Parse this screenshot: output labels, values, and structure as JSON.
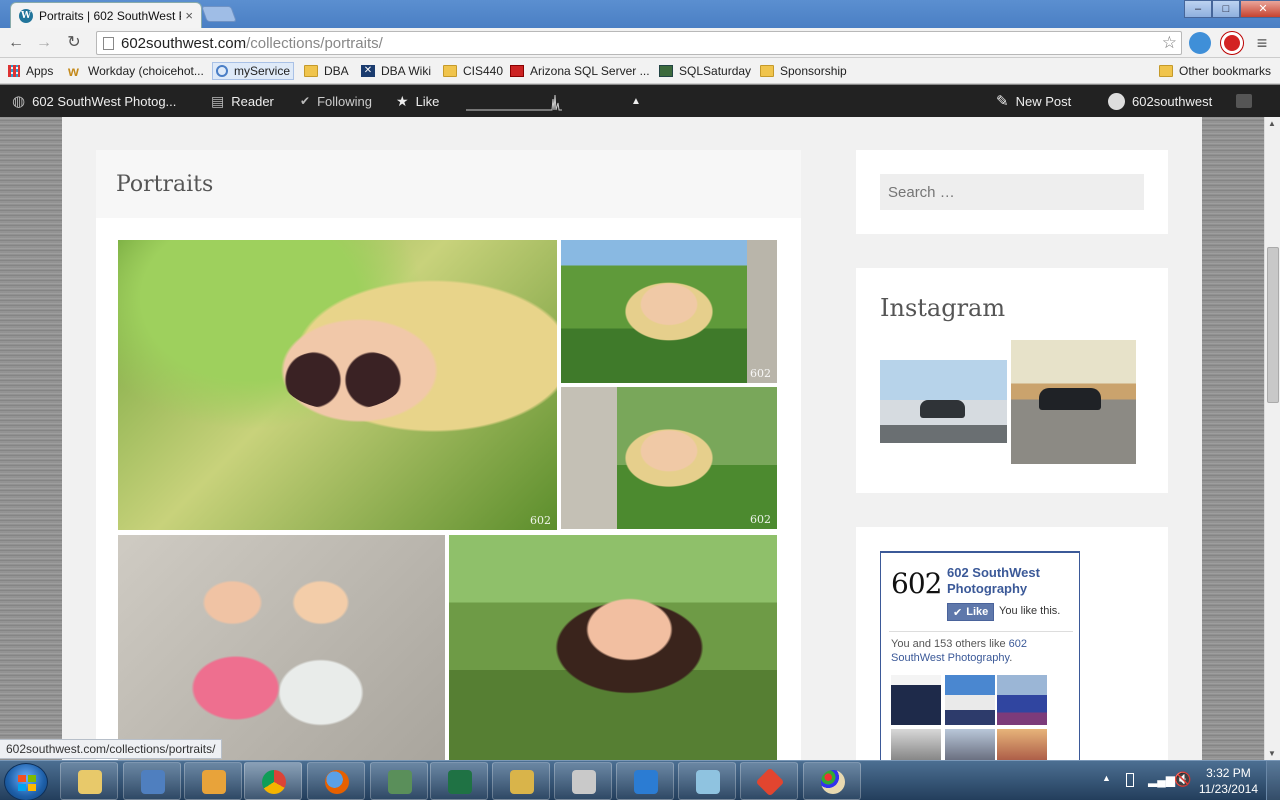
{
  "browser": {
    "tab_title": "Portraits | 602 SouthWest P",
    "tab_favicon": "W",
    "url_domain": "602southwest.com",
    "url_path": "/collections/portraits/",
    "window_controls": [
      "–",
      "□",
      "✕"
    ]
  },
  "bookmarks": [
    {
      "label": "Apps",
      "icon": "apps-grid-icon"
    },
    {
      "label": "Workday (choicehot...",
      "icon": "workday-icon"
    },
    {
      "label": "myService",
      "icon": "myservice-icon"
    },
    {
      "label": "DBA",
      "icon": "folder-icon"
    },
    {
      "label": "DBA Wiki",
      "icon": "wiki-icon"
    },
    {
      "label": "CIS440",
      "icon": "folder-icon"
    },
    {
      "label": "Arizona SQL Server ...",
      "icon": "site-icon"
    },
    {
      "label": "SQLSaturday",
      "icon": "site-icon"
    },
    {
      "label": "Sponsorship",
      "icon": "folder-icon"
    }
  ],
  "bookmarks_other": "Other bookmarks",
  "adminbar": {
    "site": "602 SouthWest Photog...",
    "reader": "Reader",
    "following": "Following",
    "like": "Like",
    "new_post": "New Post",
    "user": "602southwest"
  },
  "article": {
    "title": "Portraits"
  },
  "sidebar": {
    "search_placeholder": "Search …",
    "instagram_title": "Instagram",
    "facebook": {
      "page_name": "602 SouthWest Photography",
      "logo_text": "602",
      "like_button": "Like",
      "you_like": "You like this.",
      "count_prefix": "You and 153 others like ",
      "count_link": "602 SouthWest Photography",
      "count_suffix": "."
    }
  },
  "photo_watermark": "602",
  "status_url": "602southwest.com/collections/portraits/",
  "taskbar": {
    "time": "3:32 PM",
    "date": "11/23/2014"
  },
  "colors": {
    "wp_blue": "#21759b",
    "fb_blue": "#3b5998",
    "adminbar": "#222222"
  }
}
